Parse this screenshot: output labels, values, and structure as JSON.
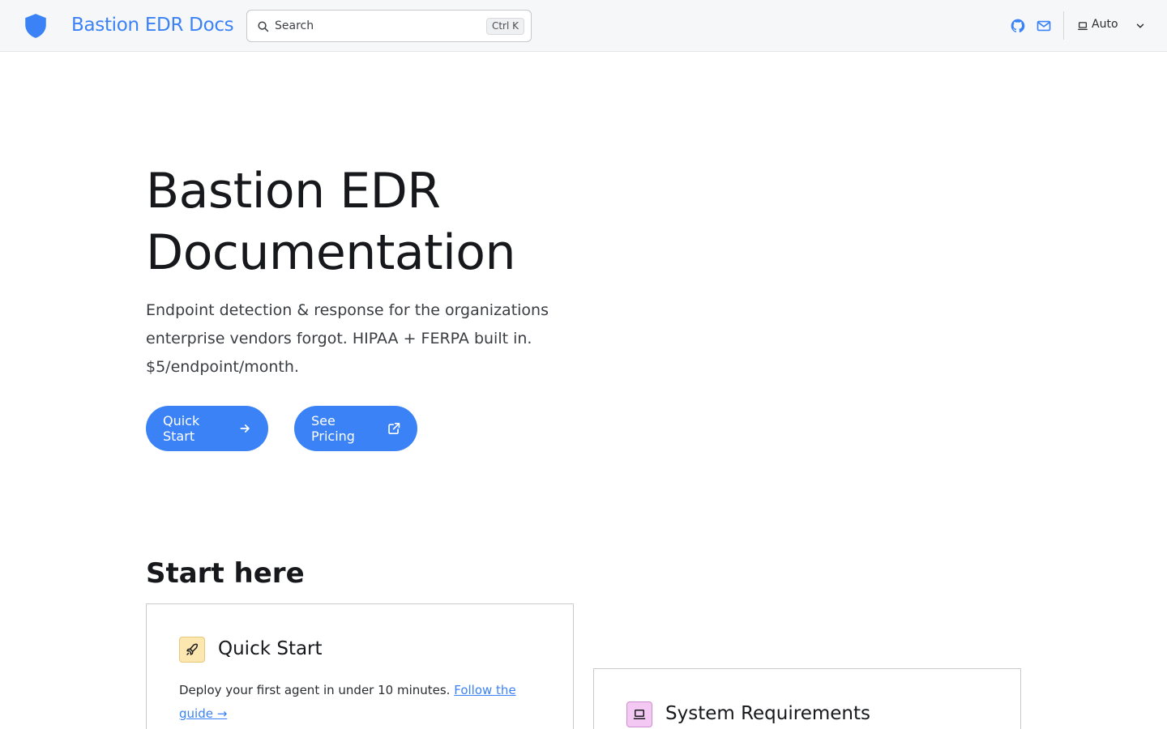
{
  "header": {
    "site_title": "Bastion EDR Docs",
    "logo_icon": "shield-icon",
    "search": {
      "placeholder": "Search",
      "shortcut": "Ctrl K"
    },
    "icons": [
      "github-icon",
      "mail-icon"
    ],
    "theme_select": {
      "value": "Auto",
      "icon": "laptop-icon"
    },
    "accent_color": "#3b82f6"
  },
  "hero": {
    "title": "Bastion EDR Documentation",
    "tagline": "Endpoint detection & response for the organizations enterprise vendors forgot. HIPAA + FERPA built in. $5/endpoint/month.",
    "buttons": [
      {
        "label": "Quick Start",
        "icon": "arrow-right-icon"
      },
      {
        "label": "See Pricing",
        "icon": "external-link-icon"
      }
    ]
  },
  "start_here": {
    "title": "Start here",
    "cards": [
      {
        "title": "Quick Start",
        "icon": "rocket-icon",
        "text": "Deploy your first agent in under 10 minutes.",
        "link": "Follow the guide →"
      },
      {
        "title": "System Requirements",
        "icon": "laptop-icon"
      }
    ]
  }
}
